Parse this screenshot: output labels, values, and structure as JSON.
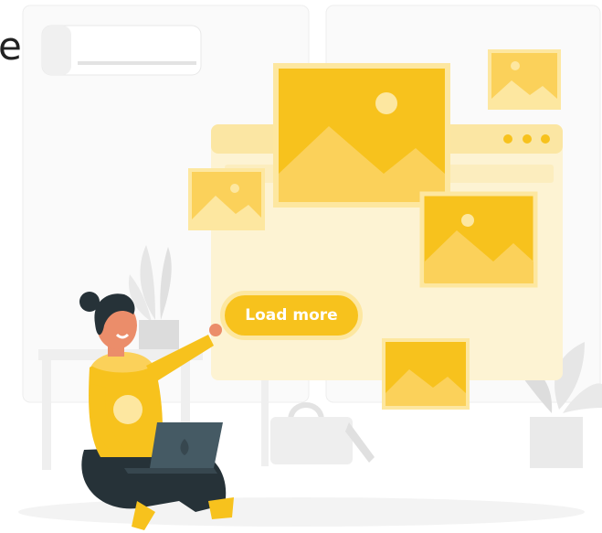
{
  "cut_char": "e",
  "button": {
    "label": "Load more"
  },
  "colors": {
    "accent": "#F7C21D",
    "accent_light": "#FDE7A0",
    "skin": "#EB8D6A",
    "hair": "#263238"
  },
  "icons": [
    "air-conditioner-icon",
    "plant-icon",
    "image-icon",
    "laptop-icon",
    "bag-icon"
  ]
}
